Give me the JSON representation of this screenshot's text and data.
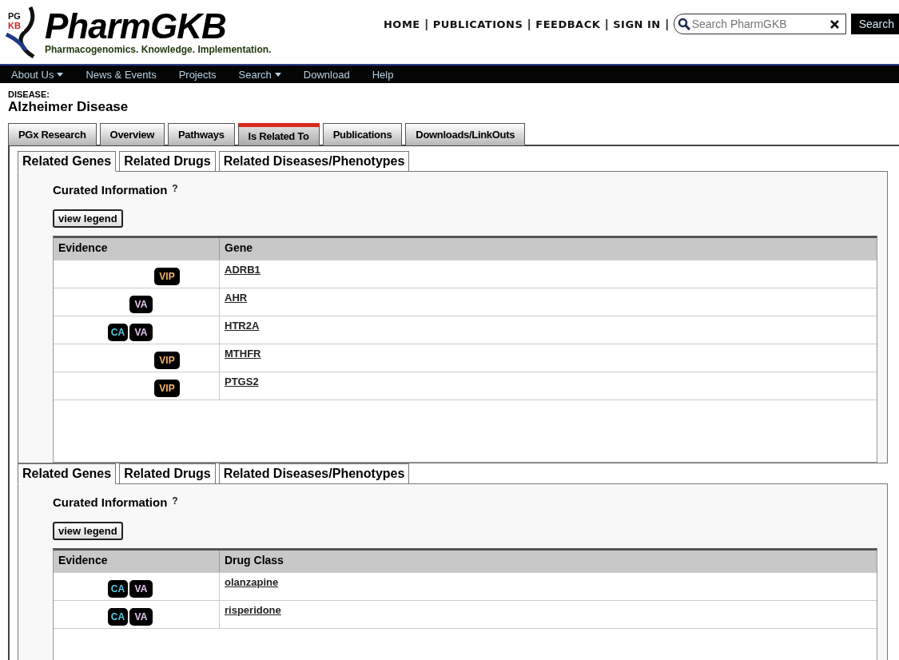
{
  "logo": {
    "mark_top": "PG",
    "mark_bottom": "KB",
    "name": "PharmGKB",
    "tagline": "Pharmacogenomics. Knowledge. Implementation."
  },
  "top_links": [
    {
      "label": "HOME"
    },
    {
      "label": "PUBLICATIONS"
    },
    {
      "label": "FEEDBACK"
    },
    {
      "label": "SIGN IN"
    }
  ],
  "separators": [
    "|",
    "|",
    "|",
    "|"
  ],
  "search": {
    "placeholder": "Search PharmGKB",
    "button": "Search"
  },
  "nav": [
    {
      "label": "About Us",
      "has_menu": true
    },
    {
      "label": "News & Events",
      "has_menu": false
    },
    {
      "label": "Projects",
      "has_menu": false
    },
    {
      "label": "Search",
      "has_menu": true
    },
    {
      "label": "Download",
      "has_menu": false
    },
    {
      "label": "Help",
      "has_menu": false
    }
  ],
  "entity_type": "DISEASE:",
  "entity_name": "Alzheimer Disease",
  "tabs": [
    {
      "label": "PGx Research",
      "selected": false
    },
    {
      "label": "Overview",
      "selected": false
    },
    {
      "label": "Pathways",
      "selected": false
    },
    {
      "label": "Is Related To",
      "selected": true
    },
    {
      "label": "Publications",
      "selected": false
    },
    {
      "label": "Downloads/LinkOuts",
      "selected": false
    }
  ],
  "sections": [
    {
      "subtabs": [
        {
          "label": "Related Genes",
          "selected": true
        },
        {
          "label": "Related Drugs",
          "selected": false
        },
        {
          "label": "Related Diseases/Phenotypes",
          "selected": false
        }
      ],
      "heading": "Curated Information",
      "help": "?",
      "legend_button": "view legend",
      "columns": [
        "Evidence",
        "Gene"
      ],
      "rows": [
        {
          "evidence": [
            {
              "kind": "vip",
              "label": "VIP"
            }
          ],
          "name": "ADRB1"
        },
        {
          "evidence": [
            {
              "kind": "va",
              "label": "VA"
            }
          ],
          "name": "AHR"
        },
        {
          "evidence": [
            {
              "kind": "ca",
              "label": "CA"
            },
            {
              "kind": "va",
              "label": "VA"
            }
          ],
          "name": "HTR2A"
        },
        {
          "evidence": [
            {
              "kind": "vip",
              "label": "VIP"
            }
          ],
          "name": "MTHFR"
        },
        {
          "evidence": [
            {
              "kind": "vip",
              "label": "VIP"
            }
          ],
          "name": "PTGS2"
        }
      ]
    },
    {
      "subtabs": [
        {
          "label": "Related Genes",
          "selected": true
        },
        {
          "label": "Related Drugs",
          "selected": false
        },
        {
          "label": "Related Diseases/Phenotypes",
          "selected": false
        }
      ],
      "heading": "Curated Information",
      "help": "?",
      "legend_button": "view legend",
      "columns": [
        "Evidence",
        "Drug Class"
      ],
      "rows": [
        {
          "evidence": [
            {
              "kind": "ca",
              "label": "CA"
            },
            {
              "kind": "va",
              "label": "VA"
            }
          ],
          "name": "olanzapine"
        },
        {
          "evidence": [
            {
              "kind": "ca",
              "label": "CA"
            },
            {
              "kind": "va",
              "label": "VA"
            }
          ],
          "name": "risperidone"
        }
      ]
    }
  ]
}
